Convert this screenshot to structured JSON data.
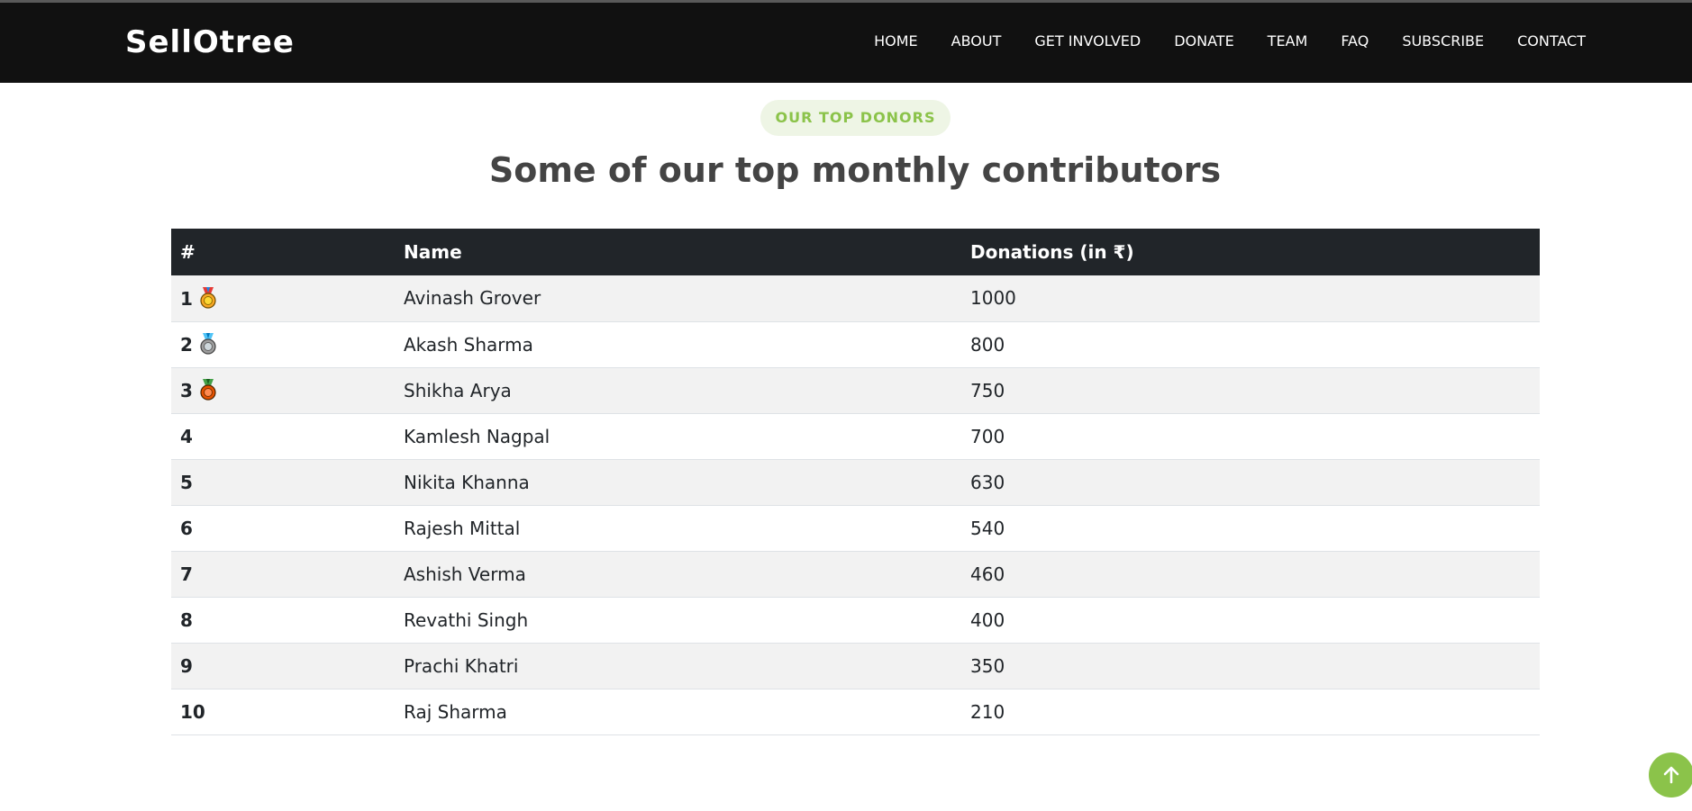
{
  "header": {
    "logo": "SellOtree",
    "nav": [
      "HOME",
      "ABOUT",
      "GET INVOLVED",
      "DONATE",
      "TEAM",
      "FAQ",
      "SUBSCRIBE",
      "CONTACT"
    ]
  },
  "section": {
    "badge": "OUR TOP DONORS",
    "title": "Some of our top monthly contributors"
  },
  "table": {
    "headers": [
      "#",
      "Name",
      "Donations (in ₹)"
    ],
    "rows": [
      {
        "rank": "1",
        "name": "Avinash Grover",
        "amount": "1000",
        "medal": "gold-medal-icon"
      },
      {
        "rank": "2",
        "name": "Akash Sharma",
        "amount": "800",
        "medal": "silver-medal-icon"
      },
      {
        "rank": "3",
        "name": "Shikha Arya",
        "amount": "750",
        "medal": "bronze-medal-icon"
      },
      {
        "rank": "4",
        "name": "Kamlesh Nagpal",
        "amount": "700"
      },
      {
        "rank": "5",
        "name": "Nikita Khanna",
        "amount": "630"
      },
      {
        "rank": "6",
        "name": "Rajesh Mittal",
        "amount": "540"
      },
      {
        "rank": "7",
        "name": "Ashish Verma",
        "amount": "460"
      },
      {
        "rank": "8",
        "name": "Revathi Singh",
        "amount": "400"
      },
      {
        "rank": "9",
        "name": "Prachi Khatri",
        "amount": "350"
      },
      {
        "rank": "10",
        "name": "Raj Sharma",
        "amount": "210"
      }
    ]
  },
  "colors": {
    "accent": "#8bc34a",
    "header_bg": "#111111",
    "table_header_bg": "#212529"
  },
  "icons": {
    "back_to_top": "arrow-up-icon"
  }
}
